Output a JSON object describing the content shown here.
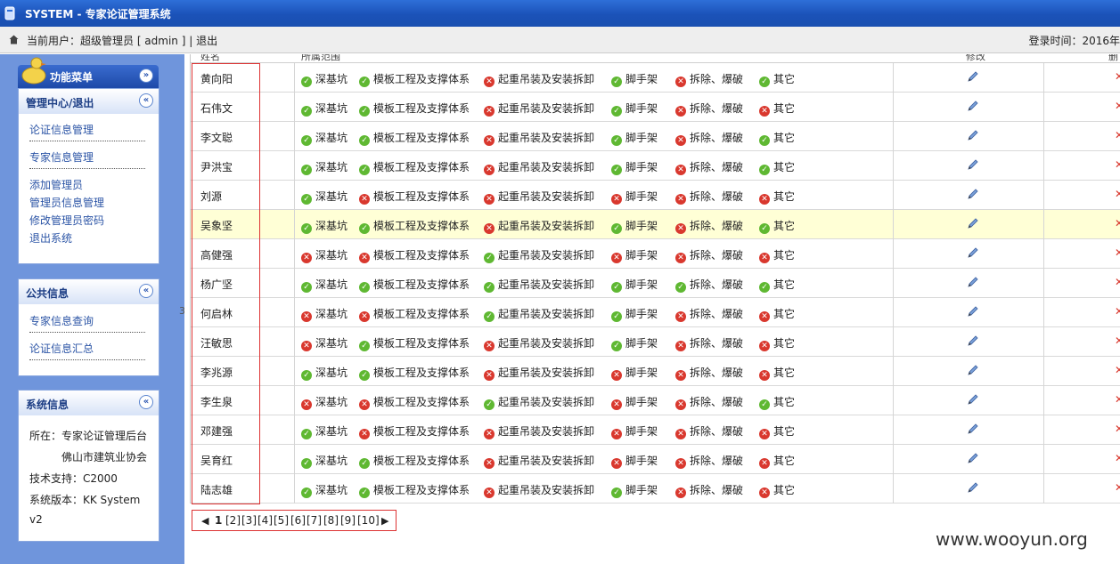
{
  "window": {
    "title": "SYSTEM - 专家论证管理系统"
  },
  "userbar": {
    "user_line": "当前用户：超级管理员 [ admin ] | 退出",
    "login_time": "登录时间：2016年"
  },
  "sidebar": {
    "menu_title": "功能菜单",
    "panels": [
      {
        "title": "管理中心/退出",
        "items": [
          "论证信息管理",
          "专家信息管理",
          "添加管理员",
          "管理员信息管理",
          "修改管理员密码",
          "退出系统"
        ]
      },
      {
        "title": "公共信息",
        "items": [
          "专家信息查询",
          "论证信息汇总"
        ]
      },
      {
        "title": "系统信息",
        "lines": [
          "所在：专家论证管理后台",
          "佛山市建筑业协会",
          "技术支持：C2000",
          "系统版本：KK System",
          "v2"
        ]
      }
    ]
  },
  "table": {
    "headers": [
      "姓名",
      "所属范围",
      "修改",
      "删除"
    ],
    "categories": [
      "深基坑",
      "模板工程及支撑体系",
      "起重吊装及安装拆卸",
      "脚手架",
      "拆除、爆破",
      "其它"
    ],
    "rows": [
      {
        "name": "黄向阳",
        "flags": [
          1,
          1,
          0,
          1,
          0,
          1
        ],
        "highlight": false
      },
      {
        "name": "石伟文",
        "flags": [
          1,
          1,
          0,
          1,
          0,
          0
        ],
        "highlight": false
      },
      {
        "name": "李文聪",
        "flags": [
          1,
          1,
          0,
          1,
          0,
          1
        ],
        "highlight": false
      },
      {
        "name": "尹洪宝",
        "flags": [
          1,
          1,
          0,
          1,
          0,
          1
        ],
        "highlight": false
      },
      {
        "name": "刘源",
        "flags": [
          1,
          0,
          0,
          0,
          0,
          0
        ],
        "highlight": false
      },
      {
        "name": "吴象坚",
        "flags": [
          1,
          1,
          0,
          1,
          0,
          1
        ],
        "highlight": true
      },
      {
        "name": "高健强",
        "flags": [
          0,
          0,
          1,
          0,
          0,
          0
        ],
        "highlight": false
      },
      {
        "name": "杨广坚",
        "flags": [
          1,
          1,
          1,
          1,
          1,
          1
        ],
        "highlight": false
      },
      {
        "name": "何启林",
        "flags": [
          0,
          0,
          1,
          1,
          0,
          0
        ],
        "highlight": false
      },
      {
        "name": "汪敏思",
        "flags": [
          0,
          1,
          0,
          1,
          0,
          0
        ],
        "highlight": false
      },
      {
        "name": "李兆源",
        "flags": [
          1,
          1,
          0,
          0,
          0,
          0
        ],
        "highlight": false
      },
      {
        "name": "李生泉",
        "flags": [
          0,
          0,
          1,
          0,
          0,
          1
        ],
        "highlight": false
      },
      {
        "name": "邓建强",
        "flags": [
          1,
          0,
          0,
          0,
          0,
          0
        ],
        "highlight": false
      },
      {
        "name": "吴育红",
        "flags": [
          1,
          1,
          0,
          0,
          0,
          0
        ],
        "highlight": false
      },
      {
        "name": "陆志雄",
        "flags": [
          1,
          1,
          0,
          1,
          0,
          0
        ],
        "highlight": false
      }
    ]
  },
  "pager": {
    "current": "1",
    "pages": [
      "[2]",
      "[3]",
      "[4]",
      "[5]",
      "[6]",
      "[7]",
      "[8]",
      "[9]",
      "[10]"
    ]
  },
  "stray_text": "3",
  "watermark": "www.wooyun.org",
  "colors": {
    "ok": "#5fb832",
    "no": "#d9382e",
    "titlebar": "#1b52b8",
    "sidebar": "#6f95dc"
  }
}
